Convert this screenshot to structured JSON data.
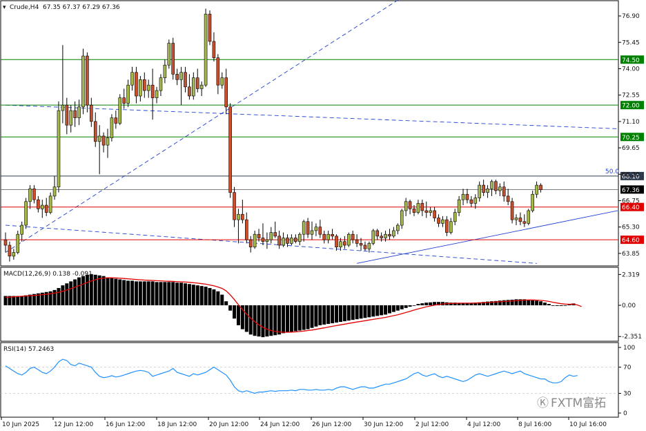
{
  "header": {
    "symbol": "Crude,H4",
    "ohlc": "67.35 67.37 67.29 67.36"
  },
  "colors": {
    "bull": "#a5b84a",
    "bear": "#c9502c",
    "wick": "#000000",
    "green_level": "#008000",
    "red_level": "#e00000",
    "dark_level": "#2f3b4d",
    "trendline": "#1f3fd0",
    "macd_bar": "#000000",
    "macd_signal": "#e00000",
    "rsi_line": "#1e90ff"
  },
  "watermark": "FXTM富拓",
  "chart_data": [
    {
      "type": "candlestick",
      "title": "Crude,H4",
      "ylim": [
        63.2,
        77.7
      ],
      "y_ticks": [
        "76.90",
        "75.45",
        "74.00",
        "72.55",
        "71.10",
        "69.65",
        "68.20",
        "66.75",
        "65.30",
        "63.85"
      ],
      "x_tick_labels": [
        "10 Jun 2025",
        "12 Jun 12:00",
        "16 Jun 12:00",
        "18 Jun 12:00",
        "20 Jun 12:00",
        "24 Jun 12:00",
        "26 Jun 12:00",
        "30 Jun 12:00",
        "2 Jul 12:00",
        "4 Jul 12:00",
        "8 Jul 16:00",
        "10 Jul 16:00"
      ],
      "levels": [
        {
          "value": 74.5,
          "label": "74.50",
          "color": "green"
        },
        {
          "value": 72.0,
          "label": "72.00",
          "color": "green"
        },
        {
          "value": 70.25,
          "label": "70.25",
          "color": "green"
        },
        {
          "value": 68.1,
          "label": "68.10",
          "color": "dark"
        },
        {
          "value": 66.4,
          "label": "66.40",
          "color": "red"
        },
        {
          "value": 64.6,
          "label": "64.60",
          "color": "red"
        }
      ],
      "current_price": {
        "value": 67.36,
        "label": "67.36"
      },
      "fib_label": "50.0",
      "trendlines": [
        {
          "from": [
            0,
            63.9
          ],
          "to": [
            99,
            78.2
          ],
          "dashed": true
        },
        {
          "from": [
            0,
            72.0
          ],
          "to": [
            202,
            70.7
          ],
          "dashed": true
        },
        {
          "from": [
            0,
            65.4
          ],
          "to": [
            130,
            63.3
          ],
          "dashed": true
        },
        {
          "from": [
            86,
            63.3
          ],
          "to": [
            202,
            66.2
          ],
          "dashed": false
        }
      ],
      "candles": [
        [
          64.6,
          65.0,
          63.9,
          64.3
        ],
        [
          64.3,
          64.5,
          63.4,
          63.7
        ],
        [
          63.7,
          64.1,
          63.5,
          63.9
        ],
        [
          63.9,
          65.1,
          63.8,
          64.9
        ],
        [
          64.9,
          65.6,
          64.5,
          65.4
        ],
        [
          65.4,
          66.9,
          65.2,
          66.7
        ],
        [
          66.7,
          67.6,
          66.3,
          67.4
        ],
        [
          67.4,
          67.6,
          66.6,
          66.8
        ],
        [
          66.8,
          67.0,
          66.1,
          66.3
        ],
        [
          66.3,
          66.8,
          65.8,
          66.5
        ],
        [
          66.5,
          66.9,
          65.9,
          66.1
        ],
        [
          66.1,
          67.2,
          66.0,
          67.0
        ],
        [
          67.0,
          68.1,
          66.8,
          67.5
        ],
        [
          67.5,
          72.2,
          67.2,
          71.7
        ],
        [
          71.7,
          75.3,
          71.0,
          72.0
        ],
        [
          72.0,
          72.4,
          70.4,
          70.9
        ],
        [
          70.9,
          72.0,
          70.5,
          71.7
        ],
        [
          71.7,
          72.2,
          70.8,
          71.3
        ],
        [
          71.3,
          72.3,
          70.9,
          71.9
        ],
        [
          71.9,
          75.1,
          71.5,
          74.7
        ],
        [
          74.7,
          74.9,
          71.6,
          72.0
        ],
        [
          72.0,
          72.4,
          70.8,
          71.1
        ],
        [
          71.1,
          71.6,
          69.7,
          70.0
        ],
        [
          70.0,
          70.9,
          68.2,
          70.3
        ],
        [
          70.3,
          70.5,
          69.4,
          69.8
        ],
        [
          69.8,
          70.7,
          69.1,
          70.2
        ],
        [
          70.2,
          71.5,
          70.0,
          71.3
        ],
        [
          71.3,
          71.7,
          70.7,
          71.0
        ],
        [
          71.0,
          72.6,
          70.9,
          72.4
        ],
        [
          72.4,
          72.9,
          71.8,
          72.1
        ],
        [
          72.1,
          73.4,
          71.9,
          73.1
        ],
        [
          73.1,
          74.1,
          72.8,
          73.8
        ],
        [
          73.8,
          74.1,
          72.1,
          72.5
        ],
        [
          72.5,
          73.6,
          72.2,
          73.4
        ],
        [
          73.4,
          73.8,
          72.4,
          72.8
        ],
        [
          72.8,
          73.4,
          72.4,
          73.1
        ],
        [
          73.1,
          74.0,
          71.2,
          72.4
        ],
        [
          72.4,
          73.0,
          72.1,
          72.8
        ],
        [
          72.8,
          73.7,
          72.5,
          73.5
        ],
        [
          73.5,
          74.5,
          73.2,
          74.2
        ],
        [
          74.2,
          75.6,
          74.0,
          75.4
        ],
        [
          75.4,
          75.7,
          73.4,
          73.7
        ],
        [
          73.7,
          74.0,
          73.1,
          73.4
        ],
        [
          73.4,
          74.1,
          72.0,
          73.8
        ],
        [
          73.8,
          74.1,
          72.7,
          73.0
        ],
        [
          73.0,
          73.7,
          72.3,
          72.5
        ],
        [
          72.5,
          73.8,
          72.3,
          73.5
        ],
        [
          73.5,
          74.0,
          72.7,
          72.9
        ],
        [
          72.9,
          73.3,
          72.5,
          73.1
        ],
        [
          73.1,
          77.3,
          73.0,
          77.0
        ],
        [
          77.0,
          77.2,
          75.3,
          75.5
        ],
        [
          75.5,
          76.0,
          74.4,
          74.6
        ],
        [
          74.6,
          74.8,
          72.6,
          73.1
        ],
        [
          73.1,
          73.8,
          72.9,
          73.5
        ],
        [
          73.5,
          74.0,
          71.5,
          71.9
        ],
        [
          71.9,
          72.1,
          66.9,
          67.2
        ],
        [
          67.2,
          67.5,
          65.3,
          65.7
        ],
        [
          65.7,
          66.3,
          64.4,
          66.0
        ],
        [
          66.0,
          66.8,
          65.5,
          65.7
        ],
        [
          65.7,
          66.1,
          64.4,
          64.6
        ],
        [
          64.6,
          64.8,
          63.9,
          64.2
        ],
        [
          64.2,
          65.1,
          64.1,
          64.9
        ],
        [
          64.9,
          65.2,
          64.5,
          64.7
        ],
        [
          64.7,
          65.5,
          64.3,
          64.5
        ],
        [
          64.5,
          65.0,
          64.1,
          64.6
        ],
        [
          64.6,
          65.3,
          64.4,
          65.0
        ],
        [
          65.0,
          65.6,
          64.7,
          64.8
        ],
        [
          64.8,
          65.1,
          64.1,
          64.3
        ],
        [
          64.3,
          65.0,
          64.2,
          64.7
        ],
        [
          64.7,
          64.9,
          64.2,
          64.4
        ],
        [
          64.4,
          64.9,
          64.3,
          64.7
        ],
        [
          64.7,
          64.9,
          64.4,
          64.5
        ],
        [
          64.5,
          65.0,
          64.3,
          64.9
        ],
        [
          64.9,
          65.7,
          64.5,
          65.6
        ],
        [
          65.6,
          65.8,
          64.7,
          64.9
        ],
        [
          64.9,
          65.6,
          64.6,
          65.1
        ],
        [
          65.1,
          65.5,
          64.8,
          65.3
        ],
        [
          65.3,
          65.7,
          64.7,
          64.9
        ],
        [
          64.9,
          65.1,
          64.4,
          64.6
        ],
        [
          64.6,
          65.1,
          64.4,
          64.9
        ],
        [
          64.9,
          65.2,
          64.6,
          64.8
        ],
        [
          64.8,
          64.9,
          64.0,
          64.2
        ],
        [
          64.2,
          64.7,
          64.0,
          64.5
        ],
        [
          64.5,
          64.8,
          64.1,
          64.3
        ],
        [
          64.3,
          65.0,
          64.2,
          64.9
        ],
        [
          64.9,
          65.1,
          64.4,
          64.6
        ],
        [
          64.6,
          64.9,
          64.2,
          64.4
        ],
        [
          64.4,
          64.7,
          64.0,
          64.3
        ],
        [
          64.3,
          64.5,
          64.0,
          64.1
        ],
        [
          64.1,
          64.5,
          63.9,
          64.4
        ],
        [
          64.4,
          65.2,
          64.3,
          65.1
        ],
        [
          65.1,
          65.2,
          64.6,
          64.8
        ],
        [
          64.8,
          65.0,
          64.5,
          64.7
        ],
        [
          64.7,
          65.1,
          64.5,
          64.9
        ],
        [
          64.9,
          65.2,
          64.6,
          64.8
        ],
        [
          64.8,
          65.3,
          64.7,
          65.1
        ],
        [
          65.1,
          65.5,
          64.9,
          65.4
        ],
        [
          65.4,
          66.3,
          65.2,
          66.2
        ],
        [
          66.2,
          66.9,
          65.9,
          66.7
        ],
        [
          66.7,
          66.8,
          66.0,
          66.3
        ],
        [
          66.3,
          66.5,
          65.9,
          66.1
        ],
        [
          66.1,
          66.8,
          66.0,
          66.6
        ],
        [
          66.6,
          66.8,
          65.9,
          66.2
        ],
        [
          66.2,
          66.7,
          65.8,
          66.1
        ],
        [
          66.1,
          66.4,
          65.9,
          66.2
        ],
        [
          66.2,
          66.4,
          65.6,
          65.8
        ],
        [
          65.8,
          66.0,
          65.3,
          65.5
        ],
        [
          65.5,
          65.9,
          65.3,
          65.7
        ],
        [
          65.7,
          65.9,
          64.8,
          65.0
        ],
        [
          65.0,
          65.8,
          64.9,
          65.6
        ],
        [
          65.6,
          66.3,
          65.4,
          66.1
        ],
        [
          66.1,
          67.0,
          65.9,
          66.8
        ],
        [
          66.8,
          67.4,
          66.5,
          67.1
        ],
        [
          67.1,
          67.4,
          66.6,
          66.8
        ],
        [
          66.8,
          67.0,
          66.4,
          66.6
        ],
        [
          66.6,
          67.1,
          66.3,
          66.9
        ],
        [
          66.9,
          67.8,
          66.7,
          67.6
        ],
        [
          67.6,
          67.9,
          67.0,
          67.2
        ],
        [
          67.2,
          67.6,
          66.9,
          67.4
        ],
        [
          67.4,
          67.9,
          67.0,
          67.8
        ],
        [
          67.8,
          67.9,
          67.1,
          67.3
        ],
        [
          67.3,
          67.7,
          67.0,
          67.5
        ],
        [
          67.5,
          67.8,
          66.7,
          67.0
        ],
        [
          67.0,
          67.4,
          66.5,
          66.7
        ],
        [
          66.7,
          66.9,
          65.5,
          65.7
        ],
        [
          65.7,
          66.0,
          65.4,
          65.8
        ],
        [
          65.8,
          66.1,
          65.4,
          65.6
        ],
        [
          65.6,
          66.0,
          65.3,
          65.5
        ],
        [
          65.5,
          66.3,
          65.4,
          66.2
        ],
        [
          66.2,
          67.3,
          66.1,
          67.1
        ],
        [
          67.1,
          67.8,
          66.9,
          67.6
        ],
        [
          67.6,
          67.7,
          67.2,
          67.35
        ]
      ]
    },
    {
      "type": "bar",
      "title": "MACD(12,26,9) 0.138 -0.091",
      "series_names": [
        "MACD",
        "Signal"
      ],
      "y_ticks": [
        "2.319",
        "0.00",
        "-2.351"
      ],
      "ylim": [
        -2.6,
        2.6
      ],
      "macd": [
        0.7,
        0.7,
        0.7,
        0.7,
        0.7,
        0.75,
        0.8,
        0.85,
        0.9,
        0.95,
        1.0,
        1.05,
        1.15,
        1.3,
        1.5,
        1.65,
        1.8,
        1.95,
        2.1,
        2.2,
        2.3,
        2.35,
        2.3,
        2.25,
        2.2,
        2.1,
        2.05,
        2.0,
        1.95,
        1.9,
        1.85,
        1.85,
        1.8,
        1.8,
        1.8,
        1.8,
        1.8,
        1.75,
        1.75,
        1.75,
        1.75,
        1.75,
        1.7,
        1.7,
        1.65,
        1.6,
        1.55,
        1.5,
        1.45,
        1.4,
        1.3,
        1.2,
        1.05,
        0.8,
        0.3,
        -0.4,
        -1.0,
        -1.5,
        -1.8,
        -2.0,
        -2.2,
        -2.3,
        -2.35,
        -2.4,
        -2.35,
        -2.3,
        -2.25,
        -2.2,
        -2.1,
        -2.05,
        -2.0,
        -1.95,
        -1.9,
        -1.85,
        -1.8,
        -1.7,
        -1.6,
        -1.5,
        -1.45,
        -1.4,
        -1.35,
        -1.3,
        -1.25,
        -1.2,
        -1.15,
        -1.1,
        -1.05,
        -1.0,
        -0.95,
        -0.9,
        -0.85,
        -0.8,
        -0.75,
        -0.7,
        -0.6,
        -0.5,
        -0.4,
        -0.3,
        -0.2,
        -0.1,
        0.0,
        0.1,
        0.15,
        0.2,
        0.22,
        0.25,
        0.25,
        0.25,
        0.22,
        0.2,
        0.2,
        0.18,
        0.15,
        0.15,
        0.18,
        0.2,
        0.22,
        0.25,
        0.28,
        0.3,
        0.32,
        0.35,
        0.38,
        0.4,
        0.42,
        0.45,
        0.45,
        0.45,
        0.42,
        0.4,
        0.35,
        0.3,
        0.2,
        0.1,
        0.0,
        -0.05,
        -0.05,
        0.0,
        0.1,
        0.138
      ],
      "signal": [
        0.6,
        0.62,
        0.64,
        0.66,
        0.68,
        0.7,
        0.72,
        0.74,
        0.77,
        0.8,
        0.83,
        0.87,
        0.92,
        0.98,
        1.06,
        1.15,
        1.25,
        1.36,
        1.48,
        1.6,
        1.72,
        1.83,
        1.93,
        2.0,
        2.05,
        2.07,
        2.07,
        2.06,
        2.04,
        2.02,
        1.99,
        1.97,
        1.94,
        1.92,
        1.9,
        1.88,
        1.87,
        1.85,
        1.84,
        1.82,
        1.81,
        1.8,
        1.78,
        1.77,
        1.75,
        1.73,
        1.7,
        1.67,
        1.63,
        1.59,
        1.53,
        1.47,
        1.38,
        1.27,
        1.08,
        0.79,
        0.43,
        0.04,
        -0.33,
        -0.66,
        -0.97,
        -1.24,
        -1.47,
        -1.66,
        -1.8,
        -1.9,
        -1.97,
        -2.01,
        -2.03,
        -2.03,
        -2.02,
        -2.0,
        -1.97,
        -1.94,
        -1.9,
        -1.86,
        -1.81,
        -1.75,
        -1.7,
        -1.64,
        -1.58,
        -1.53,
        -1.47,
        -1.42,
        -1.36,
        -1.31,
        -1.26,
        -1.21,
        -1.16,
        -1.11,
        -1.06,
        -1.01,
        -0.96,
        -0.91,
        -0.85,
        -0.78,
        -0.71,
        -0.63,
        -0.54,
        -0.45,
        -0.36,
        -0.27,
        -0.19,
        -0.11,
        -0.05,
        0.01,
        0.06,
        0.1,
        0.12,
        0.14,
        0.15,
        0.16,
        0.16,
        0.16,
        0.16,
        0.17,
        0.18,
        0.2,
        0.21,
        0.23,
        0.25,
        0.27,
        0.29,
        0.31,
        0.33,
        0.35,
        0.37,
        0.39,
        0.4,
        0.4,
        0.39,
        0.37,
        0.34,
        0.29,
        0.23,
        0.17,
        0.12,
        0.09,
        0.08,
        0.09,
        0.02,
        -0.091
      ]
    },
    {
      "type": "line",
      "title": "RSI(14) 57.2463",
      "series_names": [
        "RSI"
      ],
      "y_ticks": [
        "100",
        "70",
        "30",
        "0"
      ],
      "ylim": [
        0,
        100
      ],
      "values": [
        72,
        68,
        64,
        60,
        58,
        62,
        68,
        70,
        66,
        62,
        60,
        64,
        70,
        78,
        82,
        80,
        74,
        72,
        76,
        74,
        72,
        70,
        62,
        56,
        54,
        55,
        57,
        55,
        56,
        58,
        60,
        62,
        64,
        65,
        64,
        62,
        56,
        58,
        60,
        62,
        64,
        68,
        62,
        60,
        58,
        56,
        60,
        58,
        60,
        62,
        66,
        70,
        66,
        62,
        58,
        50,
        40,
        34,
        32,
        34,
        32,
        30,
        32,
        32,
        33,
        34,
        33,
        34,
        34,
        34,
        35,
        34,
        36,
        36,
        35,
        35,
        36,
        35,
        35,
        36,
        35,
        38,
        40,
        40,
        38,
        36,
        38,
        40,
        40,
        38,
        38,
        40,
        42,
        44,
        44,
        46,
        48,
        50,
        52,
        56,
        60,
        62,
        58,
        56,
        58,
        60,
        56,
        54,
        56,
        54,
        52,
        50,
        48,
        50,
        54,
        58,
        60,
        58,
        56,
        58,
        60,
        62,
        64,
        62,
        60,
        62,
        64,
        60,
        58,
        56,
        54,
        52,
        52,
        48,
        46,
        46,
        48,
        54,
        58,
        56,
        57.2
      ]
    }
  ]
}
